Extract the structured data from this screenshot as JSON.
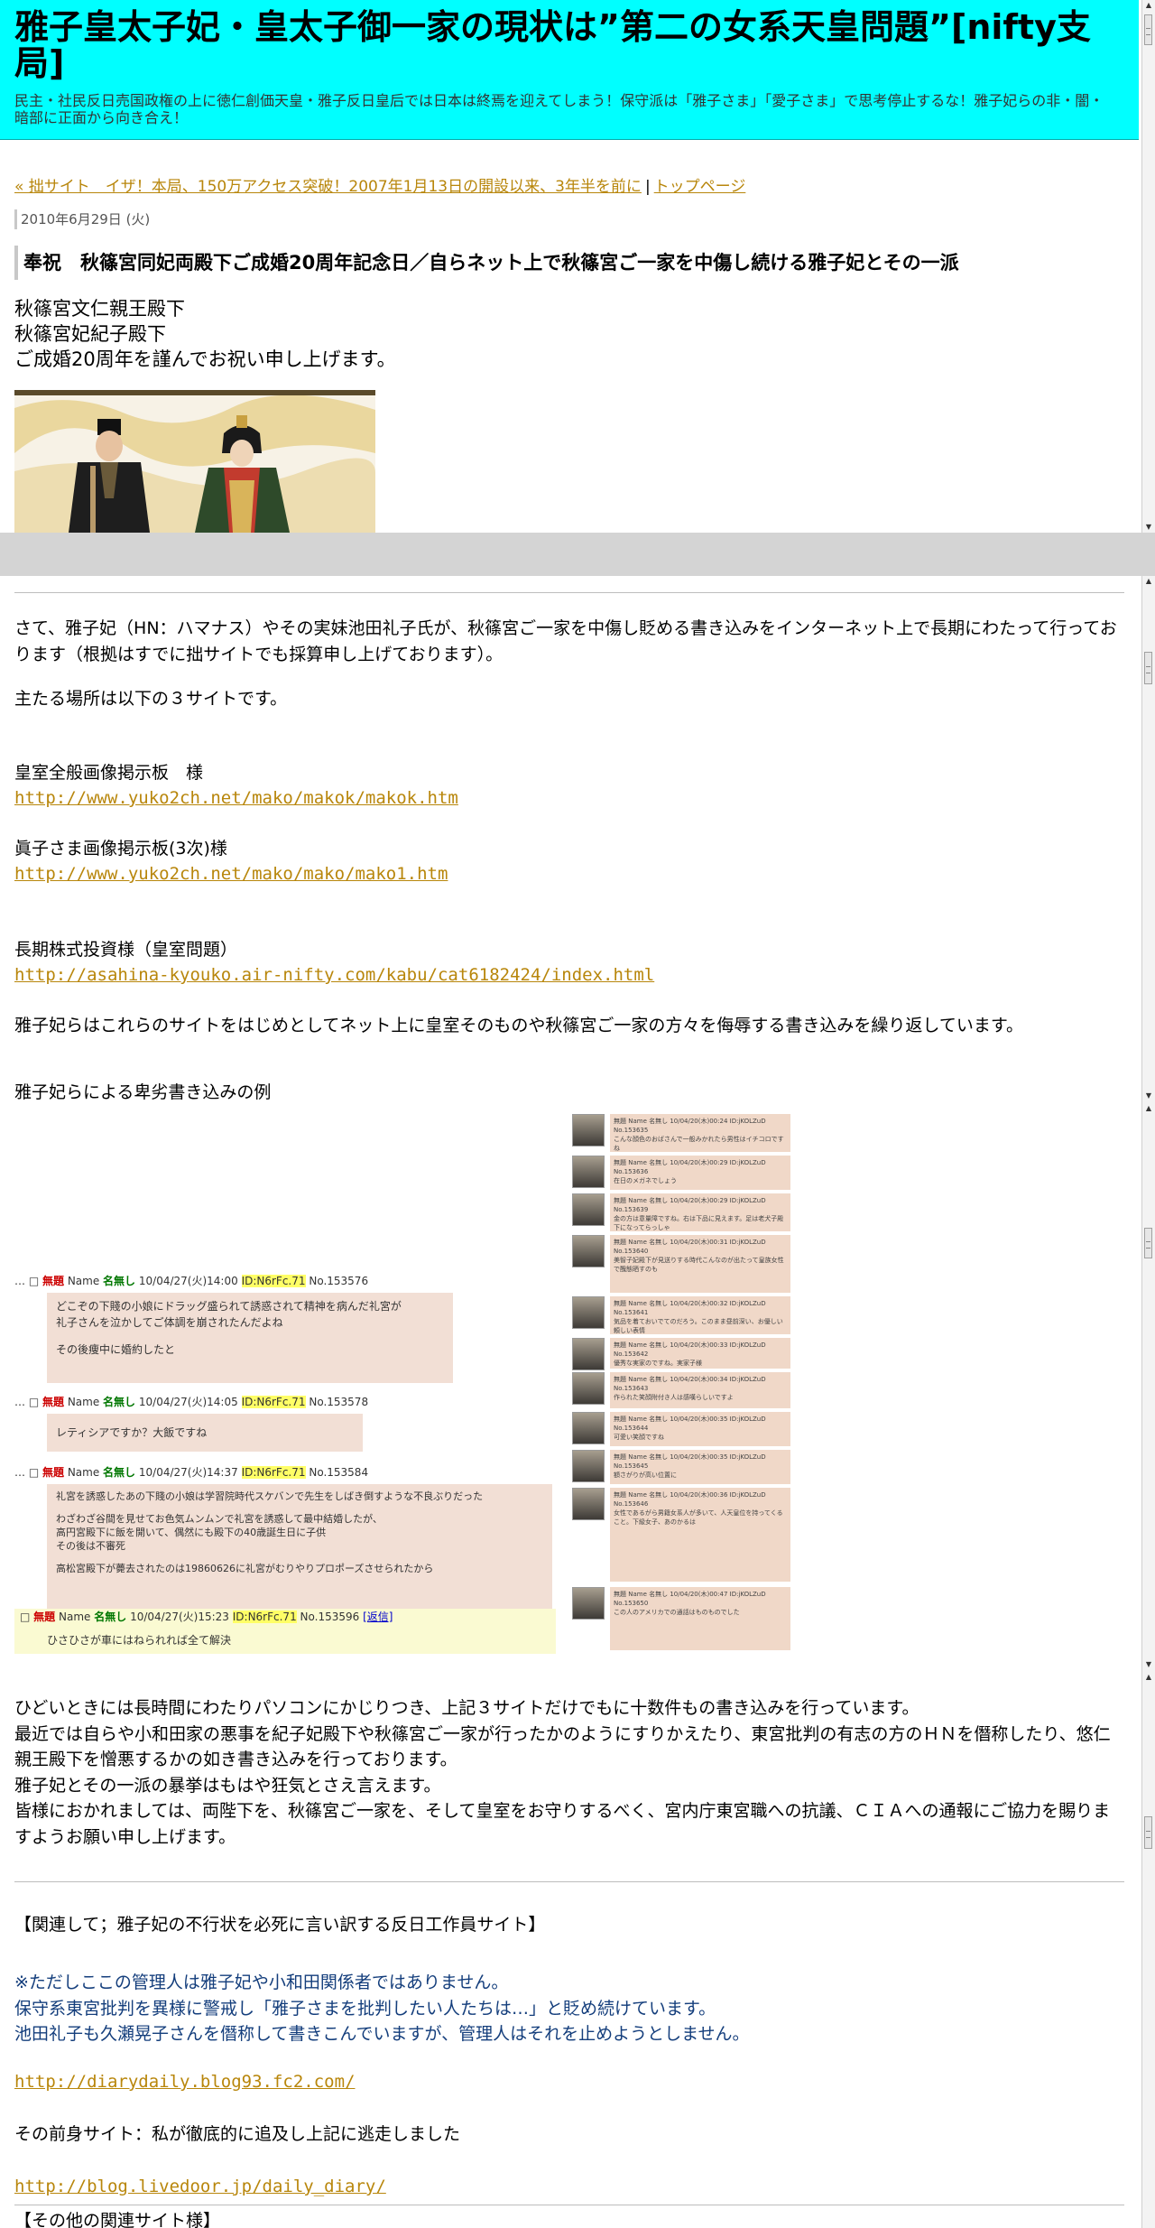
{
  "window1": {
    "header": {
      "title": "雅子皇太子妃・皇太子御一家の現状は”第二の女系天皇問題”[nifty支局]",
      "subtitle": "民主・社民反日売国政権の上に徳仁創価天皇・雅子反日皇后では日本は終焉を迎えてしまう！保守派は「雅子さま」「愛子さま」で思考停止するな！雅子妃らの非・闇・暗部に正面から向き合え！"
    },
    "nav": {
      "prev_link": "« 拙サイト　イザ！本局、150万アクセス突破！2007年1月13日の開設以来、3年半を前に",
      "separator": "|",
      "top_link": "トップページ"
    },
    "post": {
      "date": "2010年6月29日 (火)",
      "title": "奉祝　秋篠宮同妃両殿下ご成婚20周年記念日／自らネット上で秋篠宮ご一家を中傷し続ける雅子妃とその一派",
      "greeting": [
        "秋篠宮文仁親王殿下",
        "秋篠宮妃紀子殿下",
        "ご成婚20周年を謹んでお祝い申し上げます。"
      ]
    }
  },
  "window2": {
    "intro": "さて、雅子妃（HN：ハマナス）やその実妹池田礼子氏が、秋篠宮ご一家を中傷し貶める書き込みをインターネット上で長期にわたって行っております（根拠はすでに拙サイトでも採算申し上げております）。",
    "sites_intro": "主たる場所は以下の３サイトです。",
    "sites": [
      {
        "name": "皇室全般画像掲示板　様",
        "url": "http://www.yuko2ch.net/mako/makok/makok.htm"
      },
      {
        "name": "眞子さま画像掲示板(3次)様",
        "url": "http://www.yuko2ch.net/mako/mako/mako1.htm"
      },
      {
        "name": "長期株式投資様（皇室問題）",
        "url": "http://asahina-kyouko.air-nifty.com/kabu/cat6182424/index.html"
      }
    ],
    "after_sites": "雅子妃らはこれらのサイトをはじめとしてネット上に皇室そのものや秋篠宮ご一家の方々を侮辱する書き込みを繰り返しています。",
    "examples_label": "雅子妃らによる卑劣書き込みの例",
    "bbs": {
      "posts": [
        {
          "subject": "無題",
          "name_label": "Name",
          "name": "名無し",
          "datetime": "10/04/27(火)14:00",
          "id": "ID:N6rFc.71",
          "no": "No.153576",
          "lines": [
            "どこぞの下賤の小娘にドラッグ盛られて誘惑されて精神を病んだ礼宮が",
            "礼子さんを泣かしてご体調を崩されたんだよね",
            "",
            "その後痩中に婚約したと"
          ]
        },
        {
          "subject": "無題",
          "name_label": "Name",
          "name": "名無し",
          "datetime": "10/04/27(火)14:05",
          "id": "ID:N6rFc.71",
          "no": "No.153578",
          "lines": [
            "レティシアですか？大飯ですね"
          ]
        },
        {
          "subject": "無題",
          "name_label": "Name",
          "name": "名無し",
          "datetime": "10/04/27(火)14:37",
          "id": "ID:N6rFc.71",
          "no": "No.153584",
          "lines": [
            "礼宮を誘惑したあの下賤の小娘は学習院時代スケバンで先生をしばき倒すような不良ぶりだった",
            "",
            "わざわざ谷間を見せてお色気ムンムンで礼宮を誘惑して最中結婚したが、",
            "高円宮殿下に飯を開いて、偶然にも殿下の40歳誕生日に子供",
            "その後は不審死",
            "",
            "高松宮殿下が薨去されたのは19860626に礼宮がむりやりプロポーズさせられたから"
          ]
        },
        {
          "subject": "無題",
          "name_label": "Name",
          "name": "名無し",
          "datetime": "10/04/27(火)15:23",
          "id": "ID:N6rFc.71",
          "no": "No.153596",
          "reply": "[返信]",
          "lines": [
            "ひさひさが車にはねられれば全て解決"
          ]
        }
      ],
      "right_posts": [
        {
          "head": "無題 Name 名無し 10/04/20(木)00:24 ID:jKOLZuD No.153635",
          "body": "こんな顔色のおばさんで一般みかれたら男性はイチコロですね"
        },
        {
          "head": "無題 Name 名無し 10/04/20(木)00:29 ID:jKOLZuD No.153636",
          "body": "在日のメガネでしょう"
        },
        {
          "head": "無題 Name 名無し 10/04/20(木)00:29 ID:jKOLZuD No.153639",
          "body": "金の方は意量障ですね。右は下品に見えます。足は老犬子殿下になってらっしゃ"
        },
        {
          "head": "無題 Name 名無し 10/04/20(木)00:31 ID:jKOLZuD No.153640",
          "body": "美智子妃殿下が見送りする時代こんなのが出たって皇族女性で醜態晒すのも"
        },
        {
          "head": "無題 Name 名無し 10/04/20(木)00:32 ID:jKOLZuD No.153641",
          "body": "気品を着ておいでてのだろう。このまま昼前深い、お優しい頼しい表情"
        },
        {
          "head": "無題 Name 名無し 10/04/20(木)00:33 ID:jKOLZuD No.153642",
          "body": "優秀な実家のですね。実家子様"
        },
        {
          "head": "無題 Name 名無し 10/04/20(木)00:34 ID:jKOLZuD No.153643",
          "body": "作られた笑顔附付き人は感嘆らしいですよ"
        },
        {
          "head": "無題 Name 名無し 10/04/20(木)00:35 ID:jKOLZuD No.153644",
          "body": "可愛い笑顔ですね"
        },
        {
          "head": "無題 Name 名無し 10/04/20(木)00:35 ID:jKOLZuD No.153645",
          "body": "額さがりが高い位置に"
        },
        {
          "head": "無題 Name 名無し 10/04/20(木)00:36 ID:jKOLZuD No.153646",
          "body": "女性であるがら男籍女系人が多いて、人天皇位を持ってくること。下級女子、あのかるは"
        },
        {
          "head": "無題 Name 名無し 10/04/20(木)00:47 ID:jKOLZuD No.153650",
          "body": "この人のアメリカでの通話はものものでした"
        }
      ]
    },
    "paragraph": [
      "ひどいときには長時間にわたりパソコンにかじりつき、上記３サイトだけでもに十数件もの書き込みを行っています。",
      "最近では自らや小和田家の悪事を紀子妃殿下や秋篠宮ご一家が行ったかのようにすりかえたり、東宮批判の有志の方のＨＮを僭称したり、悠仁親王殿下を憎悪するかの如き書き込みを行っております。",
      "雅子妃とその一派の暴挙はもはや狂気とさえ言えます。",
      "皆様におかれましては、両陛下を、秋篠宮ご一家を、そして皇室をお守りするべく、宮内庁東宮職への抗議、ＣＩＡへの通報にご協力を賜りますようお願い申し上げます。"
    ],
    "related": {
      "heading": "【関連して；雅子妃の不行状を必死に言い訳する反日工作員サイト】",
      "notes": [
        "※ただしここの管理人は雅子妃や小和田関係者ではありません。",
        "保守系東宮批判を異様に警戒し「雅子さまを批判したい人たちは…」と貶め続けています。",
        "池田礼子も久瀬晃子さんを僭称して書きこんでいますが、管理人はそれを止めようとしません。"
      ],
      "url1": "http://diarydaily.blog93.fc2.com/",
      "predecessor": "その前身サイト：私が徹底的に追及し上記に逃走しました",
      "url2": "http://blog.livedoor.jp/daily_diary/",
      "other": "【その他の関連サイト様】"
    }
  },
  "colors": {
    "header_bg": "#00ffff",
    "link": "#b8860b",
    "note": "#143e7c"
  }
}
